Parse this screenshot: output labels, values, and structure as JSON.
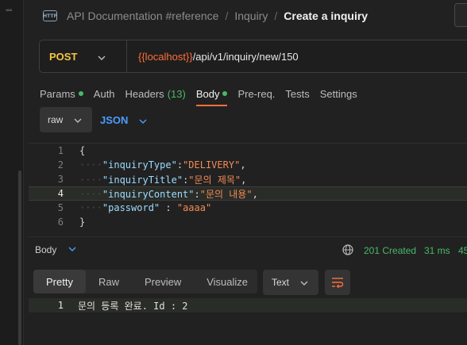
{
  "window": {
    "dots": "◦◦◦"
  },
  "breadcrumb": {
    "icon_text": "HTTP",
    "items": [
      "API Documentation #reference",
      "Inquiry"
    ],
    "separator": "/",
    "current": "Create a inquiry"
  },
  "request": {
    "method": "POST",
    "url_variable": "{{localhost}}",
    "url_path": "/api/v1/inquiry/new/150"
  },
  "request_tabs": [
    {
      "label": "Params",
      "dot": true
    },
    {
      "label": "Auth"
    },
    {
      "label": "Headers",
      "count": "(13)"
    },
    {
      "label": "Body",
      "dot": true,
      "active": true
    },
    {
      "label": "Pre-req."
    },
    {
      "label": "Tests"
    },
    {
      "label": "Settings"
    }
  ],
  "body_mode": {
    "type": "raw",
    "format": "JSON"
  },
  "editor": {
    "highlighted_line": 4,
    "lines": [
      {
        "num": "1",
        "open": "{"
      },
      {
        "num": "2",
        "key": "\"inquiryType\"",
        "sep": ":",
        "value": "\"DELIVERY\"",
        "end": ","
      },
      {
        "num": "3",
        "key": "\"inquiryTitle\"",
        "sep": ":",
        "value": "\"문의 제목\"",
        "end": ","
      },
      {
        "num": "4",
        "key": "\"inquiryContent\"",
        "sep": ":",
        "value": "\"문의 내용\"",
        "end": ","
      },
      {
        "num": "5",
        "key": "\"password\"",
        "sep": " : ",
        "value": "\"aaaa\"",
        "end": ""
      },
      {
        "num": "6",
        "open": "}"
      }
    ]
  },
  "response": {
    "label": "Body",
    "status": "201 Created",
    "time": "31 ms",
    "size": "45",
    "view_tabs": [
      {
        "label": "Pretty",
        "active": true
      },
      {
        "label": "Raw"
      },
      {
        "label": "Preview"
      },
      {
        "label": "Visualize"
      }
    ],
    "format": "Text",
    "lines": [
      {
        "num": "1",
        "text": "문의 등록 완료. Id : 2"
      }
    ]
  },
  "colors": {
    "accent": "#ff6f3c",
    "method_post": "#f5c542",
    "success": "#49b86a",
    "link": "#4c9dff"
  }
}
